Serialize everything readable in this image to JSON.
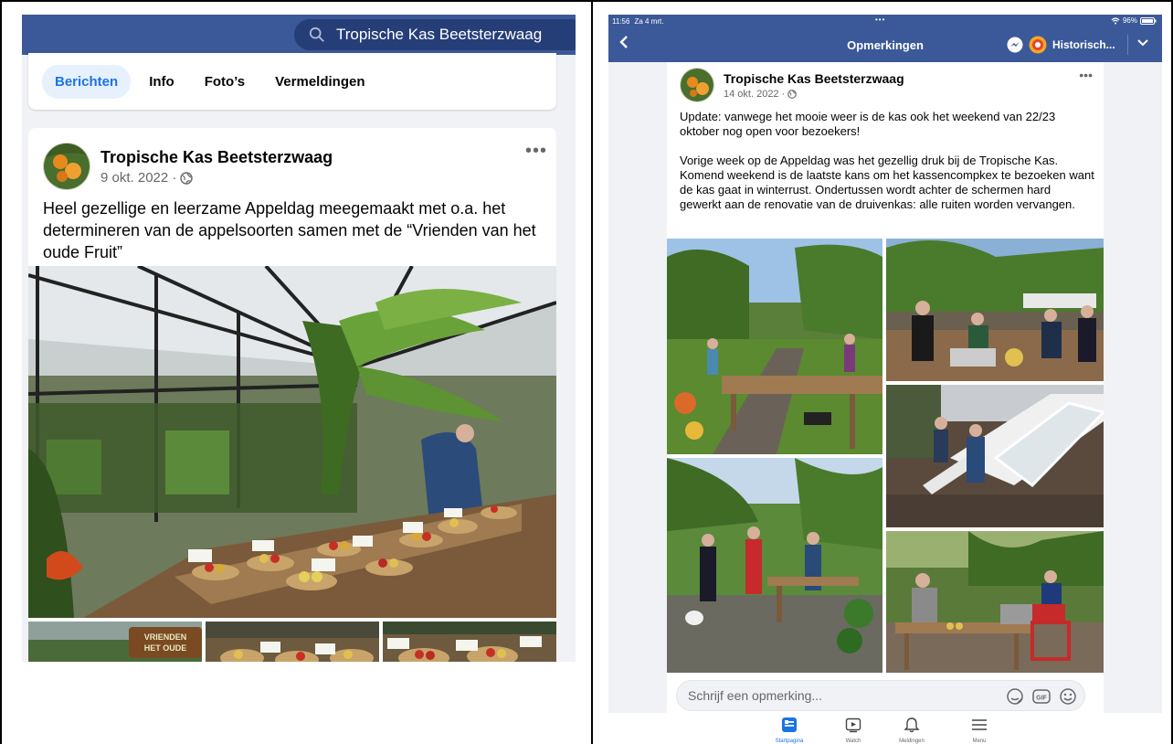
{
  "left": {
    "search": {
      "text": "Tropische Kas Beetsterzwaag",
      "icon": "search-icon"
    },
    "tabs": [
      {
        "label": "Berichten",
        "active": true
      },
      {
        "label": "Info",
        "active": false
      },
      {
        "label": "Foto’s",
        "active": false
      },
      {
        "label": "Vermeldingen",
        "active": false
      }
    ],
    "post": {
      "page_name": "Tropische Kas Beetsterzwaag",
      "date": "9 okt. 2022 ·",
      "more": "•••",
      "text": "Heel gezellige en leerzame Appeldag meegemaakt met o.a. het determineren van de appelsoorten samen met de “Vrienden van het oude Fruit”",
      "thumb_sign": "VRIENDEN HET OUDE"
    }
  },
  "right": {
    "status": {
      "time": "11:56",
      "date": "Za 4 mrt.",
      "dots": "•••",
      "battery": "96%"
    },
    "nav": {
      "title": "Opmerkingen",
      "history": "Historisch..."
    },
    "post": {
      "page_name": "Tropische Kas Beetsterzwaag",
      "date": "14 okt. 2022 ·",
      "more": "•••",
      "text1": "Update: vanwege het mooie weer is de kas ook het weekend van 22/23 oktober nog open voor bezoekers!",
      "text2": "Vorige week op de Appeldag was het gezellig druk bij de Tropische Kas. Komend weekend is de laatste kans om het kassencompkex te bezoeken want de kas gaat in winterrust. Ondertussen wordt achter de schermen hard gewerkt aan de renovatie van de druivenkas: alle ruiten worden vervangen."
    },
    "comment": {
      "placeholder": "Schrijf een opmerking...",
      "gif": "GIF"
    },
    "tabbar": [
      {
        "label": "Startpagina",
        "icon": "home-icon",
        "active": true
      },
      {
        "label": "Watch",
        "icon": "watch-icon",
        "active": false
      },
      {
        "label": "Meldingen",
        "icon": "bell-icon",
        "active": false
      },
      {
        "label": "Menu",
        "icon": "menu-icon",
        "active": false
      }
    ]
  },
  "colors": {
    "fb_blue": "#3b5998",
    "link_blue": "#1b74e4",
    "background": "#f0f2f5"
  }
}
